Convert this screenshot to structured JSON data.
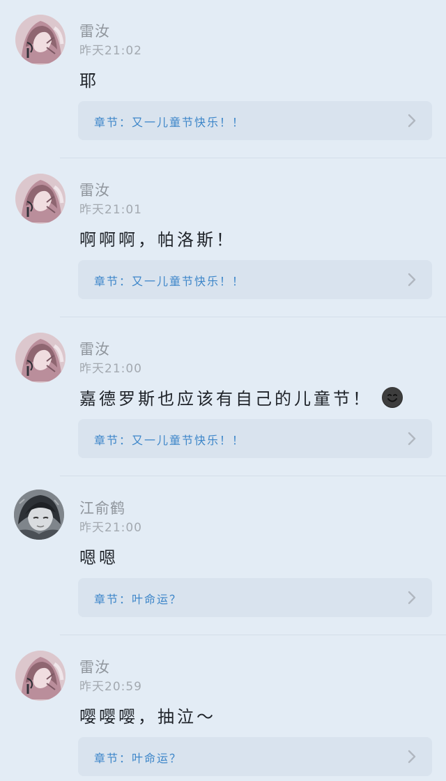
{
  "comments": [
    {
      "username": "雷汝",
      "time": "昨天21:02",
      "text": "耶",
      "chapter": "章节：又一儿童节快乐！！",
      "avatar_icon": "pink-anime-girl-avatar"
    },
    {
      "username": "雷汝",
      "time": "昨天21:01",
      "text": "啊啊啊，帕洛斯！",
      "chapter": "章节：又一儿童节快乐！！",
      "avatar_icon": "pink-anime-girl-avatar"
    },
    {
      "username": "雷汝",
      "time": "昨天21:00",
      "text": "嘉德罗斯也应该有自己的儿童节！",
      "emoji_icon": "smiling-face-emoji-icon",
      "chapter": "章节：又一儿童节快乐！！",
      "avatar_icon": "pink-anime-girl-avatar"
    },
    {
      "username": "江俞鹤",
      "time": "昨天21:00",
      "text": "嗯嗯",
      "chapter": "章节：叶命运？",
      "avatar_icon": "gray-anime-boy-avatar"
    },
    {
      "username": "雷汝",
      "time": "昨天20:59",
      "text": "嘤嘤嘤，抽泣～",
      "chapter": "章节：叶命运？",
      "avatar_icon": "pink-anime-girl-avatar"
    }
  ]
}
